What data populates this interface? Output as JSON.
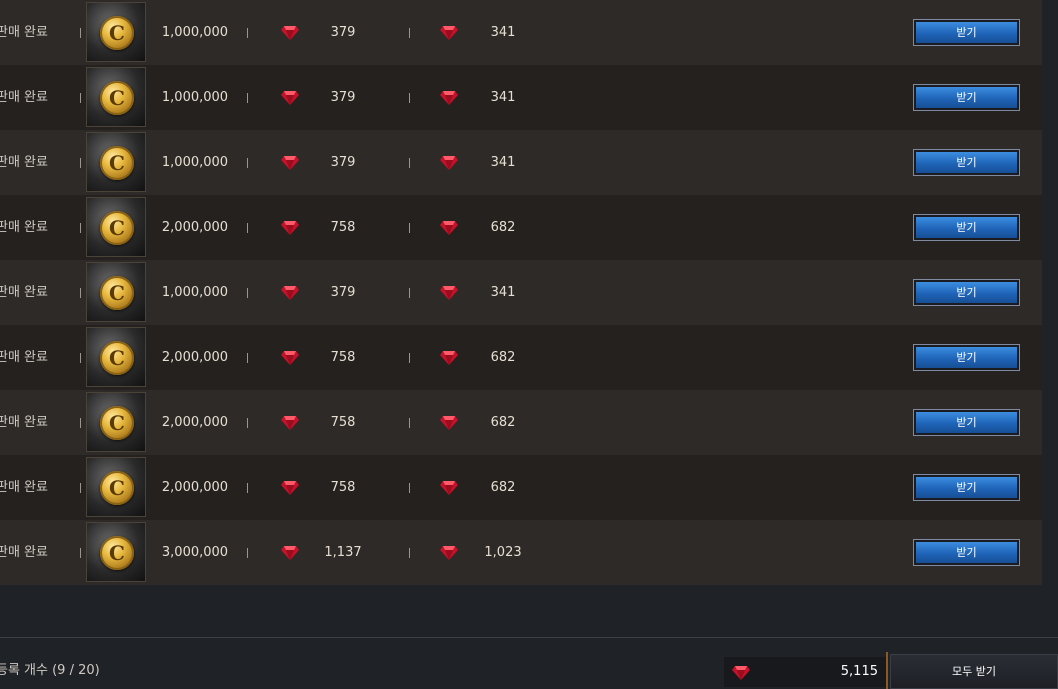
{
  "rows": [
    {
      "status": "판매 완료",
      "price": "1,000,000",
      "gem_price": "379",
      "gem_receive": "341",
      "button": "받기"
    },
    {
      "status": "판매 완료",
      "price": "1,000,000",
      "gem_price": "379",
      "gem_receive": "341",
      "button": "받기"
    },
    {
      "status": "판매 완료",
      "price": "1,000,000",
      "gem_price": "379",
      "gem_receive": "341",
      "button": "받기"
    },
    {
      "status": "판매 완료",
      "price": "2,000,000",
      "gem_price": "758",
      "gem_receive": "682",
      "button": "받기"
    },
    {
      "status": "판매 완료",
      "price": "1,000,000",
      "gem_price": "379",
      "gem_receive": "341",
      "button": "받기"
    },
    {
      "status": "판매 완료",
      "price": "2,000,000",
      "gem_price": "758",
      "gem_receive": "682",
      "button": "받기"
    },
    {
      "status": "판매 완료",
      "price": "2,000,000",
      "gem_price": "758",
      "gem_receive": "682",
      "button": "받기"
    },
    {
      "status": "판매 완료",
      "price": "2,000,000",
      "gem_price": "758",
      "gem_receive": "682",
      "button": "받기"
    },
    {
      "status": "판매 완료",
      "price": "3,000,000",
      "gem_price": "1,137",
      "gem_receive": "1,023",
      "button": "받기"
    }
  ],
  "item": {
    "icon": "gold-coin-icon",
    "letter": "C"
  },
  "gem_icon": "red-gem-icon",
  "footer": {
    "registered_count": "등록 개수 (9 / 20)",
    "total_value": "5,115",
    "receive_all": "모두 받기"
  },
  "colors": {
    "button_blue": "#1f64b8",
    "gem_red": "#d0142c",
    "coin_gold": "#e7b83e"
  }
}
